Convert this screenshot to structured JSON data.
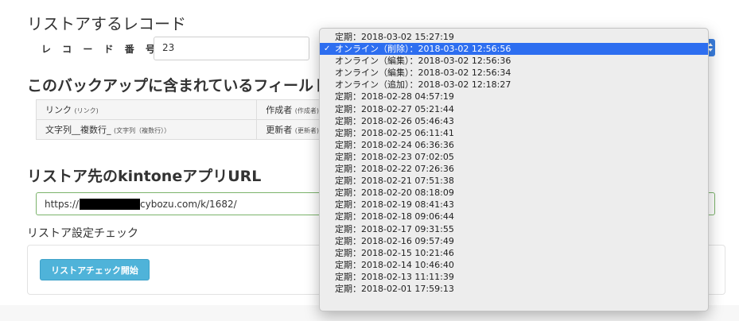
{
  "page": {
    "title": "リストアするレコード",
    "record_label": "レ コ ー ド 番 号 ：",
    "record_value": "23",
    "fields_title": "このバックアップに含まれているフィールド",
    "fields": [
      {
        "name": "リンク",
        "type": "(リンク)",
        "name2": "作成者",
        "type2": "(作成者)"
      },
      {
        "name": "文字列__複数行_",
        "type": "(文字列（複数行））",
        "name2": "更新者",
        "type2": "(更新者)"
      }
    ],
    "url_title": "リストア先のkintoneアプリURL",
    "url_prefix": "https://",
    "url_suffix": "cybozu.com/k/1682/",
    "check_title": "リストア設定チェック",
    "check_button": "リストアチェック開始"
  },
  "dropdown": {
    "selected_index": 1,
    "check_mark": "✓",
    "options": [
      "定期：2018-03-02 15:27:19",
      "オンライン（削除）：2018-03-02 12:56:56",
      "オンライン（編集）：2018-03-02 12:56:36",
      "オンライン（編集）：2018-03-02 12:56:34",
      "オンライン（追加）：2018-03-02 12:18:27",
      "定期：2018-02-28 04:57:19",
      "定期：2018-02-27 05:21:44",
      "定期：2018-02-26 05:46:43",
      "定期：2018-02-25 06:11:41",
      "定期：2018-02-24 06:36:36",
      "定期：2018-02-23 07:02:05",
      "定期：2018-02-22 07:26:36",
      "定期：2018-02-21 07:51:38",
      "定期：2018-02-20 08:18:09",
      "定期：2018-02-19 08:41:43",
      "定期：2018-02-18 09:06:44",
      "定期：2018-02-17 09:31:55",
      "定期：2018-02-16 09:57:49",
      "定期：2018-02-15 10:21:46",
      "定期：2018-02-14 10:46:40",
      "定期：2018-02-13 11:11:39",
      "定期：2018-02-01 17:59:13"
    ]
  },
  "colors": {
    "selected_bg": "#2d6ef0",
    "button_bg": "#4fb3d9",
    "url_border": "#7bb36b"
  }
}
